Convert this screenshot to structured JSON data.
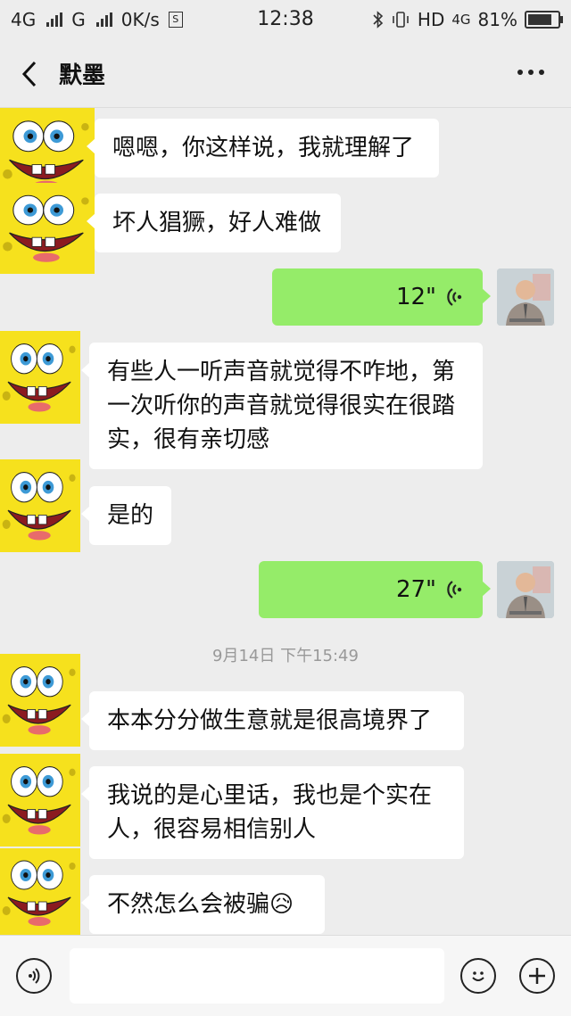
{
  "status_bar": {
    "sim1": "4G",
    "sim2": "G",
    "speed": "0K/s",
    "s_badge": "S",
    "time": "12:38",
    "hd": "HD",
    "net": "4G",
    "battery": "81%",
    "battery_level": 0.81
  },
  "nav": {
    "back_icon": "chevron-left-icon",
    "title": "默墨",
    "more_icon": "more-dots-icon"
  },
  "messages": [
    {
      "side": "in",
      "type": "text",
      "text": "嗯嗯，你这样说，我就理解了"
    },
    {
      "side": "in",
      "type": "text",
      "text": "坏人猖獗，好人难做"
    },
    {
      "side": "out",
      "type": "voice",
      "duration": "12\""
    },
    {
      "side": "in",
      "type": "text",
      "lines": [
        "有些人一听声音就觉得不咋地，第",
        "一次听你的声音就觉得很实在很踏",
        "实，很有亲切感"
      ]
    },
    {
      "side": "in",
      "type": "text",
      "text": "是的"
    },
    {
      "side": "out",
      "type": "voice",
      "duration": "27\""
    },
    {
      "type": "timestamp",
      "text": "9月14日 下午15:49"
    },
    {
      "side": "in",
      "type": "text",
      "text": "本本分分做生意就是很高境界了"
    },
    {
      "side": "in",
      "type": "text",
      "lines": [
        "我说的是心里话，我也是个实在",
        "人，很容易相信别人"
      ]
    },
    {
      "side": "in",
      "type": "text",
      "text": "不然怎么会被骗",
      "emoji": "😥"
    }
  ],
  "input_bar": {
    "voice_icon": "voice-mode-icon",
    "emoji_icon": "emoji-icon",
    "plus_icon": "plus-icon",
    "input_value": ""
  },
  "colors": {
    "background": "#ededed",
    "out_bubble": "#95ec69",
    "in_bubble": "#ffffff"
  }
}
